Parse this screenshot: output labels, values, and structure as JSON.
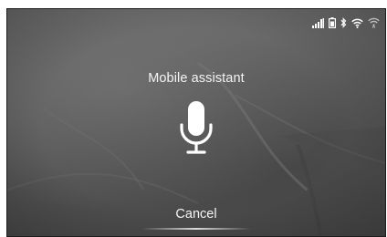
{
  "screen": {
    "title": "Mobile assistant",
    "cancel_label": "Cancel"
  },
  "status_bar": {
    "icons": [
      "signal-strength-icon",
      "phone-battery-icon",
      "bluetooth-icon",
      "wifi-icon",
      "wifi-hotspot-icon"
    ]
  },
  "mic": {
    "icon": "microphone-icon"
  },
  "colors": {
    "background": "#5b5b5b",
    "text": "#f4f4f4",
    "icons": "#ffffff"
  }
}
